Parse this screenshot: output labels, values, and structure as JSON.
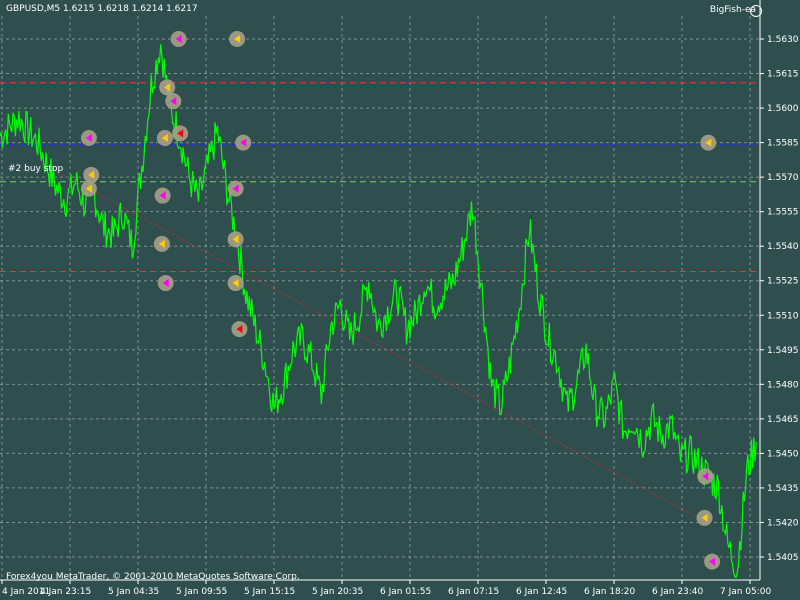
{
  "header": {
    "symbol_info": "GBPUSD,M5  1.6215 1.6218 1.6214 1.6217",
    "ea_name": "BigFish-ea",
    "ea_icon": "smiley-icon"
  },
  "footer": {
    "copyright": "Forex4you MetaTrader, © 2001-2010 MetaQuotes Software Corp."
  },
  "annotations": {
    "order_label": "#2 buy stop"
  },
  "colors": {
    "background": "#2f4f4f",
    "price_line": "#00ff00",
    "grid": "#c0c0c0",
    "axis": "#ffffff",
    "level_red": "#ff2a2a",
    "level_blue": "#1a2aff",
    "trend_line": "#b03030"
  },
  "chart_data": {
    "type": "line",
    "ylim": [
      1.5395,
      1.564
    ],
    "y_ticks": [
      1.563,
      1.5615,
      1.56,
      1.5585,
      1.557,
      1.5555,
      1.554,
      1.5525,
      1.551,
      1.5495,
      1.548,
      1.5465,
      1.545,
      1.5435,
      1.542,
      1.5405
    ],
    "y_tick_labels": [
      "1.5630",
      "1.5615",
      "1.5600",
      "1.5585",
      "1.5570",
      "1.5555",
      "1.5540",
      "1.5525",
      "1.5510",
      "1.5495",
      "1.5480",
      "1.5465",
      "1.5450",
      "1.5435",
      "1.5420",
      "1.5405"
    ],
    "x_tick_labels": [
      "4 Jan 2011",
      "4 Jan 23:15",
      "5 Jan 04:35",
      "5 Jan 09:55",
      "5 Jan 15:15",
      "5 Jan 20:35",
      "6 Jan 01:55",
      "6 Jan 07:15",
      "6 Jan 12:45",
      "6 Jan 18:20",
      "6 Jan 23:40",
      "7 Jan 05:00"
    ],
    "series": [
      {
        "values": [
          1.5588,
          1.5592,
          1.5596,
          1.559,
          1.5585,
          1.5575,
          1.5565,
          1.556,
          1.5568,
          1.5558,
          1.5562,
          1.5548,
          1.5545,
          1.5555,
          1.554,
          1.5575,
          1.561,
          1.5628,
          1.56,
          1.5588,
          1.557,
          1.556,
          1.5575,
          1.559,
          1.5565,
          1.5545,
          1.552,
          1.5505,
          1.549,
          1.547,
          1.548,
          1.5495,
          1.55,
          1.549,
          1.5475,
          1.5505,
          1.5515,
          1.55,
          1.551,
          1.5525,
          1.5505,
          1.5512,
          1.552,
          1.5505,
          1.551,
          1.5525,
          1.5515,
          1.552,
          1.5525,
          1.554,
          1.5558,
          1.552,
          1.548,
          1.547,
          1.549,
          1.5515,
          1.5548,
          1.552,
          1.55,
          1.549,
          1.547,
          1.548,
          1.5495,
          1.547,
          1.5465,
          1.548,
          1.546,
          1.5465,
          1.5455,
          1.5465,
          1.5458,
          1.5462,
          1.5448,
          1.545,
          1.5445,
          1.544,
          1.5435,
          1.541,
          1.54,
          1.5442,
          1.5455
        ]
      }
    ],
    "levels": [
      {
        "name": "upper-red-level",
        "value": 1.5611,
        "color": "#ff2a2a",
        "style": "dashed"
      },
      {
        "name": "lower-red-level",
        "value": 1.5529,
        "color": "#ff2a2a",
        "style": "dashed"
      },
      {
        "name": "blue-level",
        "value": 1.5584,
        "color": "#1a2aff",
        "style": "dashed"
      },
      {
        "name": "green-level",
        "value": 1.5568,
        "color": "#6bd16b",
        "style": "dashed"
      }
    ],
    "markers": [
      {
        "x": 0.235,
        "y": 1.563,
        "color": "#ff00ff"
      },
      {
        "x": 0.312,
        "y": 1.563,
        "color": "#ffcc00"
      },
      {
        "x": 0.22,
        "y": 1.5609,
        "color": "#ffcc00"
      },
      {
        "x": 0.228,
        "y": 1.5603,
        "color": "#ff00ff"
      },
      {
        "x": 0.117,
        "y": 1.5587,
        "color": "#ff00ff"
      },
      {
        "x": 0.217,
        "y": 1.5587,
        "color": "#ffcc00"
      },
      {
        "x": 0.237,
        "y": 1.5589,
        "color": "#ff0000"
      },
      {
        "x": 0.32,
        "y": 1.5585,
        "color": "#ff00ff"
      },
      {
        "x": 0.932,
        "y": 1.5585,
        "color": "#ffcc00"
      },
      {
        "x": 0.12,
        "y": 1.5571,
        "color": "#ffcc00"
      },
      {
        "x": 0.117,
        "y": 1.5565,
        "color": "#ffcc00"
      },
      {
        "x": 0.214,
        "y": 1.5562,
        "color": "#ff00ff"
      },
      {
        "x": 0.31,
        "y": 1.5565,
        "color": "#ff00ff"
      },
      {
        "x": 0.31,
        "y": 1.5543,
        "color": "#ffcc00"
      },
      {
        "x": 0.213,
        "y": 1.5541,
        "color": "#ffcc00"
      },
      {
        "x": 0.218,
        "y": 1.5524,
        "color": "#ff00ff"
      },
      {
        "x": 0.31,
        "y": 1.5524,
        "color": "#ffcc00"
      },
      {
        "x": 0.315,
        "y": 1.5504,
        "color": "#ff0000"
      },
      {
        "x": 0.928,
        "y": 1.544,
        "color": "#ff00ff"
      },
      {
        "x": 0.927,
        "y": 1.5422,
        "color": "#ffcc00"
      },
      {
        "x": 0.937,
        "y": 1.5403,
        "color": "#ff00ff"
      }
    ],
    "trend_line": {
      "from": [
        0.06,
        1.5575
      ],
      "to": [
        0.93,
        1.542
      ]
    }
  }
}
